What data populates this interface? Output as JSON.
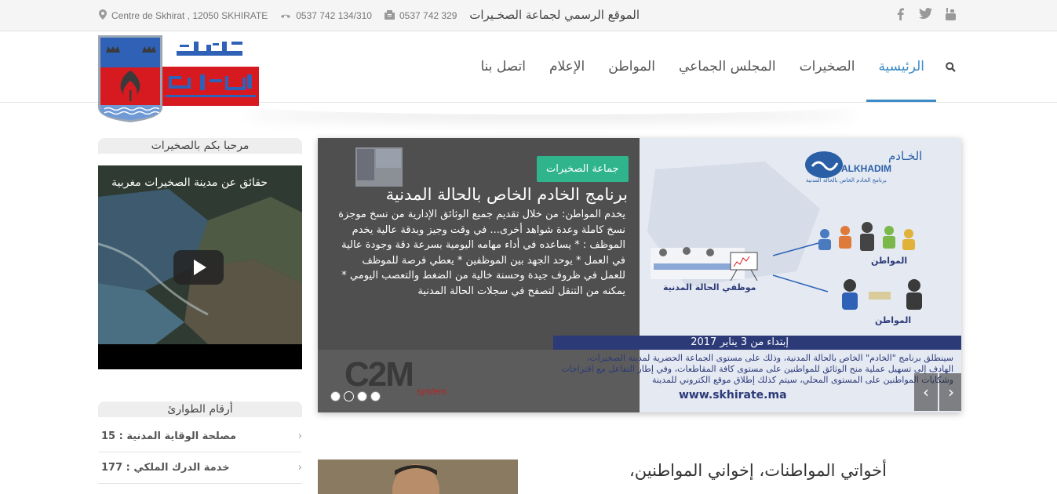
{
  "topbar": {
    "official_site": "الموقع الرسمي لجماعة الصخـيرات",
    "address": "Centre de Skhirat , 12050 SKHIRATE",
    "phone": "0537 742 134/310",
    "fax": "0537 742 329",
    "social": [
      {
        "name": "facebook-icon",
        "glyph": "f"
      },
      {
        "name": "twitter-icon",
        "glyph": "t"
      },
      {
        "name": "youtube-icon",
        "glyph": "▶"
      }
    ]
  },
  "nav": {
    "items": [
      {
        "label": "الرئيسية",
        "active": true
      },
      {
        "label": "الصخيرات",
        "active": false
      },
      {
        "label": "المجلس الجماعي",
        "active": false
      },
      {
        "label": "المواطن",
        "active": false
      },
      {
        "label": "الإعلام",
        "active": false
      },
      {
        "label": "اتصل بنا",
        "active": false
      }
    ]
  },
  "sidebar": {
    "welcome_title": "مرحبا بكم بالصخيرات",
    "video_title": "حقائق عن مدينة الصخيرات مغربية",
    "emergency_title": "أرقام الطوارئ",
    "emergency_items": [
      {
        "label": "مصلحة الوقاية المدنية : 15"
      },
      {
        "label": "خدمة الدرك الملكي : 177"
      }
    ]
  },
  "slider": {
    "badge": "جماعة الصخيرات",
    "title": "برنامج الخادم الخاص بالحالة المدنية",
    "text": "يخدم المواطن: من خلال تقديم جميع الوثائق الإدارية من نسخ موجزة نسخ كاملة وعدة شواهد أخرى... في وقت وجيز وبدقة عالية يخدم الموظف : * يساعده في أداء مهامه اليومية بسرعة دقة وجودة عالية في العمل * يوحد الجهد بين الموظفين * يعطي فرصة للموظف للعمل في ظروف جيدة وحسنة خالية من الضغط والتعصب اليومي * يمكنه من التنقل لتصفح في سجلات الحالة المدنية",
    "image": {
      "brand_ar": "الخـادم",
      "brand": "ALKHADIM",
      "brand_sub": "برنامج الخادم الخاص بالحالة المدنية",
      "citizen_1": "المواطن",
      "citizen_2": "المواطن",
      "employee": "موظفي الحالة المدنية",
      "start_date": "إبتداء من 3 يناير 2017",
      "description": "سينطلق برنامج \"الخادم\" الخاص بالحالة المدنية، وذلك على مستوى الجماعة الحضرية لمدينة الصخيرات، الهادف إلى تسهيل عملية منح الوثائق للمواطنين على مستوى كافة المقاطعات، وفي إطار التفاعل مع اقتراحات وشكايات المواطنين على المستوى المحلي، سيتم كذلك إطلاق موقع الكتروني للمدينة",
      "url": "www.skhirate.ma",
      "c2m": "C2M",
      "c2m_sub": "system"
    },
    "dots": 4,
    "active_dot": 1
  },
  "article": {
    "greeting": "أخواتي المواطنات، إخواني المواطنين،"
  },
  "colors": {
    "accent": "#3a8bc6",
    "badge": "#2fb48c",
    "brand_navy": "#2c3a78"
  }
}
